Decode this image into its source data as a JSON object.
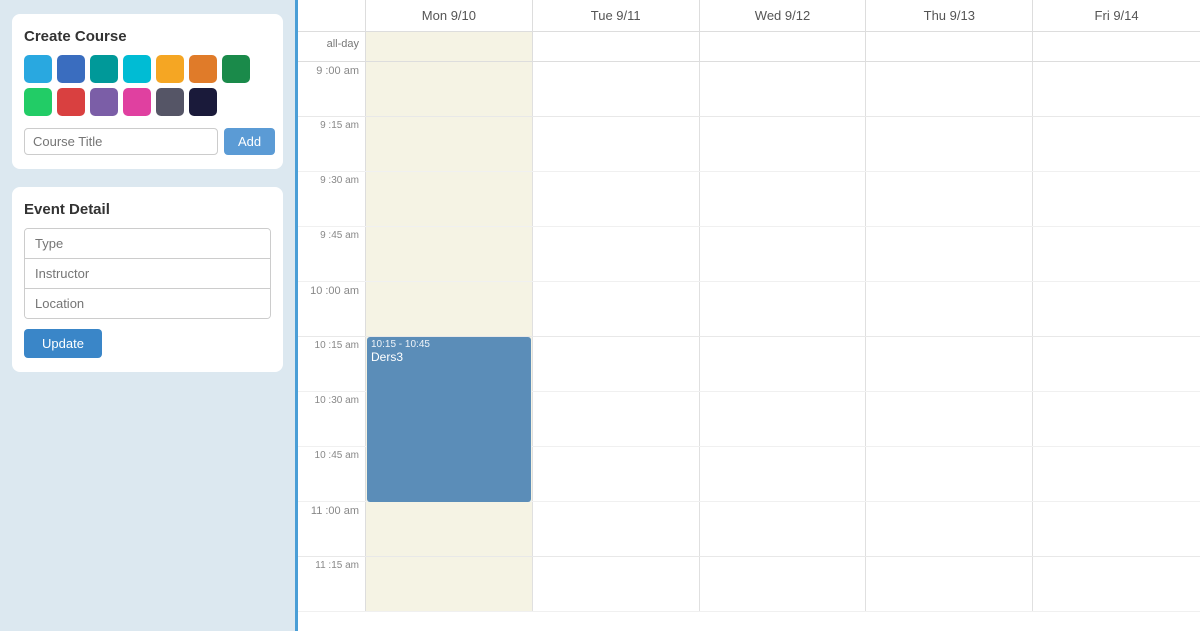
{
  "leftPanel": {
    "createCourse": {
      "title": "Create Course",
      "colors": [
        {
          "id": "blue-light",
          "hex": "#29a8e0"
        },
        {
          "id": "blue-mid",
          "hex": "#3a6dbf"
        },
        {
          "id": "teal",
          "hex": "#009999"
        },
        {
          "id": "cyan",
          "hex": "#00bcd4"
        },
        {
          "id": "orange",
          "hex": "#f5a623"
        },
        {
          "id": "amber",
          "hex": "#e07b29"
        },
        {
          "id": "green-dark",
          "hex": "#1a8a4a"
        },
        {
          "id": "green-light",
          "hex": "#22cc66"
        },
        {
          "id": "red",
          "hex": "#d94040"
        },
        {
          "id": "purple",
          "hex": "#7b5ea7"
        },
        {
          "id": "pink",
          "hex": "#e040a0"
        },
        {
          "id": "gray-dark",
          "hex": "#555566"
        },
        {
          "id": "navy",
          "hex": "#1a1a3a"
        }
      ],
      "titlePlaceholder": "Course Title",
      "addLabel": "Add"
    },
    "eventDetail": {
      "title": "Event Detail",
      "typePlaceholder": "Type",
      "instructorPlaceholder": "Instructor",
      "locationPlaceholder": "Location",
      "updateLabel": "Update"
    }
  },
  "calendar": {
    "days": [
      {
        "label": "Mon 9/10"
      },
      {
        "label": "Tue 9/11"
      },
      {
        "label": "Wed 9/12"
      },
      {
        "label": "Thu 9/13"
      },
      {
        "label": "Fri 9/14"
      }
    ],
    "allDayLabel": "all-day",
    "todayIndex": 0,
    "timeSlots": [
      {
        "label": "9 :00 am",
        "isHour": true
      },
      {
        "label": "9 :15 am",
        "isHour": false
      },
      {
        "label": "9 :30 am",
        "isHour": false
      },
      {
        "label": "9 :45 am",
        "isHour": false
      },
      {
        "label": "10 :00 am",
        "isHour": true
      },
      {
        "label": "10 :15 am",
        "isHour": false
      },
      {
        "label": "10 :30 am",
        "isHour": false
      },
      {
        "label": "10 :45 am",
        "isHour": false
      },
      {
        "label": "11 :00 am",
        "isHour": true
      },
      {
        "label": "11 :15 am",
        "isHour": false
      }
    ],
    "events": [
      {
        "id": "event1",
        "title": "Ders3",
        "timeLabel": "10:15 - 10:45",
        "dayIndex": 0,
        "startSlot": 5,
        "spanSlots": 3,
        "color": "#5b8db8"
      }
    ]
  }
}
